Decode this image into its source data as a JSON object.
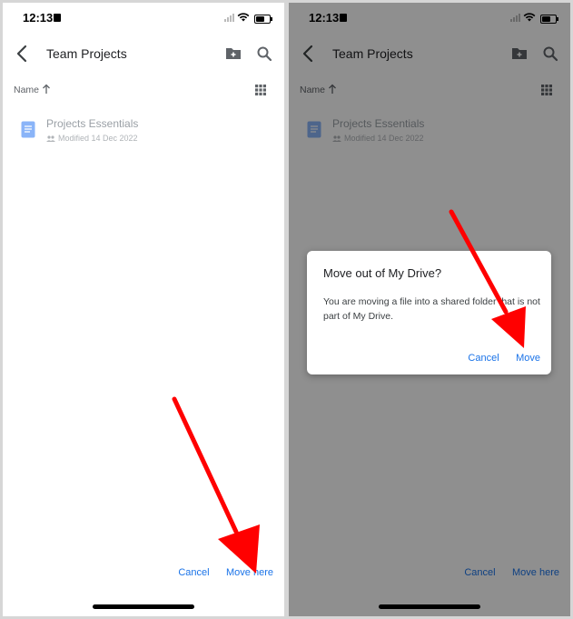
{
  "status_bar": {
    "time": "12:13"
  },
  "app_bar": {
    "title": "Team Projects"
  },
  "sort": {
    "label": "Name"
  },
  "file": {
    "name": "Projects Essentials",
    "modified": "Modified 14 Dec 2022"
  },
  "actions": {
    "cancel": "Cancel",
    "move_here": "Move here"
  },
  "dialog": {
    "title": "Move out of My Drive?",
    "body": "You are moving a file into a shared folder that is not part of My Drive.",
    "cancel": "Cancel",
    "move": "Move"
  },
  "colors": {
    "accent": "#1a73e8",
    "arrow": "#ff0000",
    "doc_icon": "#8ab4f8"
  }
}
